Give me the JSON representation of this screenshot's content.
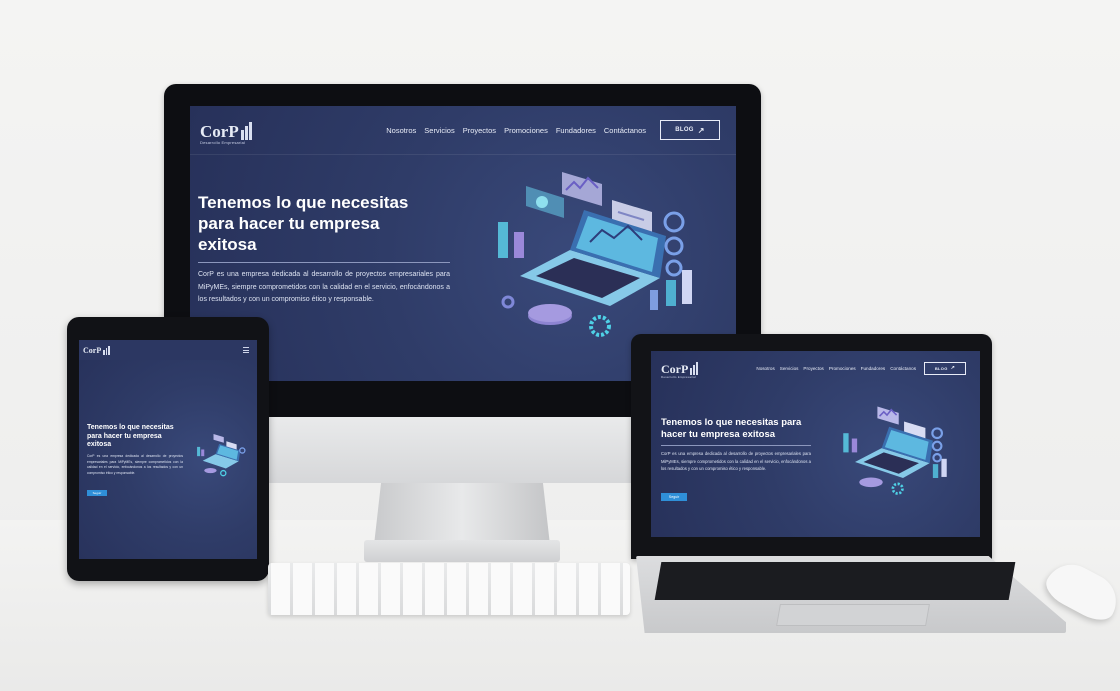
{
  "site": {
    "logo": "CorP",
    "logo_tagline": "Desarrollo Empresarial",
    "nav": [
      "Nosotros",
      "Servicios",
      "Proyectos",
      "Promociones",
      "Fundadores",
      "Contáctanos"
    ],
    "blog_label": "BLOG",
    "hero_title_desktop": "Tenemos lo que necesitas para hacer tu empresa exitosa",
    "hero_title_laptop": "Tenemos lo que necesitas para hacer tu empresa exitosa",
    "hero_text": "CorP es una empresa dedicada al desarrollo de proyectos empresariales para MiPyMEs, siempre comprometidos con la calidad en el servicio, enfocándonos a los resultados y con un compromiso ético y responsable.",
    "tweet_label": "Seguir",
    "menu_icon": "hamburger-icon"
  },
  "colors": {
    "hero_bg": "#2f3c68",
    "accent": "#4fd1e6",
    "tweet": "#2f8fd8"
  }
}
